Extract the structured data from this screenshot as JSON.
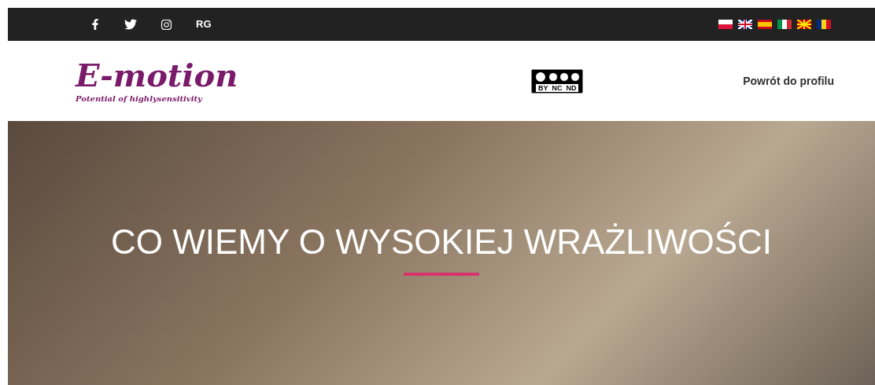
{
  "top_bar": {
    "social": [
      {
        "kind": "facebook"
      },
      {
        "kind": "twitter"
      },
      {
        "kind": "instagram"
      },
      {
        "kind": "text",
        "label": "RG"
      }
    ],
    "flags": [
      {
        "kind": "pl"
      },
      {
        "kind": "gb"
      },
      {
        "kind": "es"
      },
      {
        "kind": "it"
      },
      {
        "kind": "mk"
      },
      {
        "kind": "ro"
      }
    ]
  },
  "header": {
    "logo_title": "E-motion",
    "logo_tagline": "Potential of highlysensitivity",
    "license_badge": [
      "BY",
      "NC",
      "ND"
    ],
    "nav_link": "Powrót do profilu"
  },
  "hero": {
    "title": "CO WIEMY O WYSOKIEJ WRAŻLIWOŚCI"
  }
}
